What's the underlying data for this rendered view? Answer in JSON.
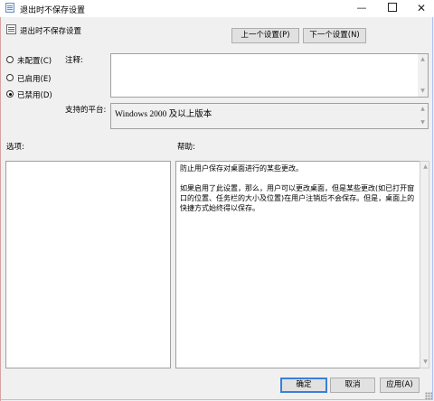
{
  "window": {
    "title": "退出时不保存设置",
    "minimize": "—",
    "close": "✕"
  },
  "header": {
    "setting_name": "退出时不保存设置",
    "prev_button": "上一个设置(P)",
    "next_button": "下一个设置(N)"
  },
  "state": {
    "options": [
      {
        "label": "未配置(C)",
        "selected": false
      },
      {
        "label": "已启用(E)",
        "selected": false
      },
      {
        "label": "已禁用(D)",
        "selected": true
      }
    ]
  },
  "labels": {
    "comment": "注释:",
    "supported_on": "支持的平台:",
    "options": "选项:",
    "help": "帮助:"
  },
  "comment_value": "",
  "supported_on_value": "Windows 2000 及以上版本",
  "help_text": [
    "防止用户保存对桌面进行的某些更改。",
    "如果启用了此设置，那么，用户可以更改桌面，但是某些更改(如已打开窗口的位置、任务栏的大小及位置)在用户注销后不会保存。但是，桌面上的快捷方式始终得以保存。"
  ],
  "footer": {
    "ok": "确定",
    "cancel": "取消",
    "apply": "应用(A)"
  },
  "icons": {
    "window": "policy-setting-icon",
    "scroll_up": "▲",
    "scroll_down": "▼"
  }
}
